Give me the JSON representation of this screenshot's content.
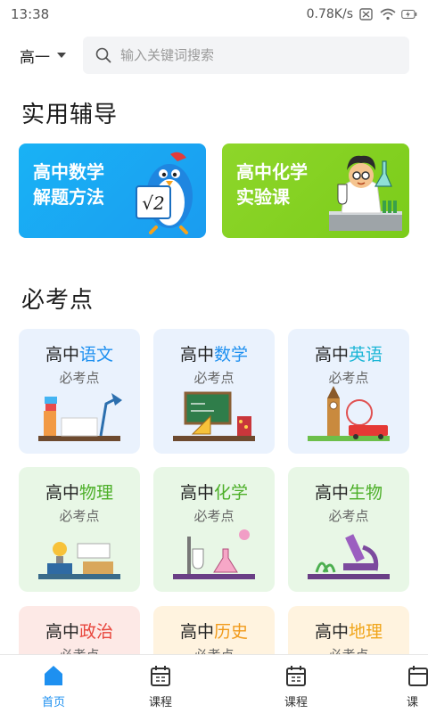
{
  "status_bar": {
    "time": "13:38",
    "network_speed": "0.78K/s"
  },
  "search": {
    "grade": "高一",
    "placeholder": "输入关键词搜索"
  },
  "sections": {
    "practical": "实用辅导",
    "must_test": "必考点"
  },
  "features": [
    {
      "line1": "高中数学",
      "line2": "解题方法"
    },
    {
      "line1": "高中化学",
      "line2": "实验课"
    }
  ],
  "subjects": [
    {
      "prefix": "高中",
      "subject": "语文",
      "sub": "必考点",
      "color": "#1e90f0"
    },
    {
      "prefix": "高中",
      "subject": "数学",
      "sub": "必考点",
      "color": "#1e90f0"
    },
    {
      "prefix": "高中",
      "subject": "英语",
      "sub": "必考点",
      "color": "#1bb5d6"
    },
    {
      "prefix": "高中",
      "subject": "物理",
      "sub": "必考点",
      "color": "#4caf28"
    },
    {
      "prefix": "高中",
      "subject": "化学",
      "sub": "必考点",
      "color": "#4caf28"
    },
    {
      "prefix": "高中",
      "subject": "生物",
      "sub": "必考点",
      "color": "#4caf28"
    },
    {
      "prefix": "高中",
      "subject": "政治",
      "sub": "必考点",
      "color": "#e8453c"
    },
    {
      "prefix": "高中",
      "subject": "历史",
      "sub": "必考点",
      "color": "#f19a1a"
    },
    {
      "prefix": "高中",
      "subject": "地理",
      "sub": "必考点",
      "color": "#f0a51a"
    }
  ],
  "tabs": [
    {
      "label": "首页",
      "icon": "home-icon"
    },
    {
      "label": "课程",
      "icon": "calendar-icon"
    },
    {
      "label": "课程",
      "icon": "calendar-icon"
    },
    {
      "label": "课",
      "icon": "calendar-icon"
    }
  ],
  "colors": {
    "accent": "#1e90f0"
  }
}
